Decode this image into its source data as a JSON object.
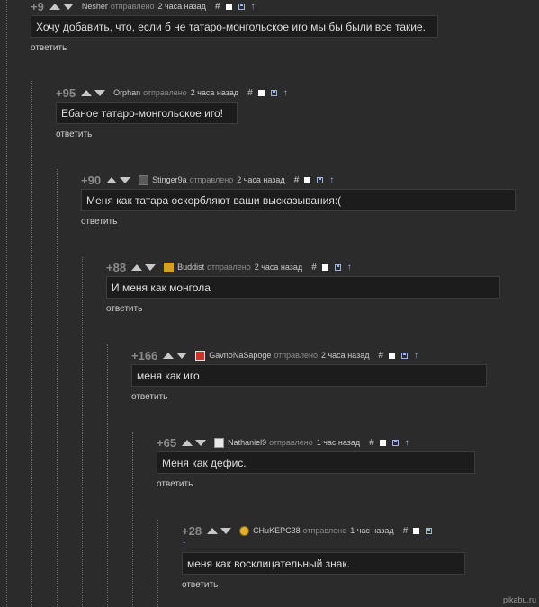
{
  "comments": [
    {
      "rating": "+9",
      "author": "Nesher",
      "sent": "отправлено",
      "time": "2 часа назад",
      "text": "Хочу добавить, что, если б не татаро-монгольское иго мы бы были все такие.",
      "reply": "ответить",
      "avatar": null
    },
    {
      "rating": "+95",
      "author": "Orphan",
      "sent": "отправлено",
      "time": "2 часа назад",
      "text": "Ебаное татаро-монгольское иго!",
      "reply": "ответить",
      "avatar": null
    },
    {
      "rating": "+90",
      "author": "Stinger9a",
      "sent": "отправлено",
      "time": "2 часа назад",
      "text": "Меня как татара оскорбляют ваши высказывания:(",
      "reply": "ответить",
      "avatar": "user-avatar"
    },
    {
      "rating": "+88",
      "author": "Buddist",
      "sent": "отправлено",
      "time": "2 часа назад",
      "text": "И меня как монгола",
      "reply": "ответить",
      "avatar": "user-avatar"
    },
    {
      "rating": "+166",
      "author": "GavnoNaSapoge",
      "sent": "отправлено",
      "time": "2 часа назад",
      "text": "меня как иго",
      "reply": "ответить",
      "avatar": "user-avatar"
    },
    {
      "rating": "+65",
      "author": "Nathaniel9",
      "sent": "отправлено",
      "time": "1 час назад",
      "text": "Меня как дефис.",
      "reply": "ответить",
      "avatar": "user-avatar"
    },
    {
      "rating": "+28",
      "author": "CHuKEPC38",
      "sent": "отправлено",
      "time": "1 час назад",
      "text": "меня как восклицательный знак.",
      "reply": "ответить",
      "avatar": "user-avatar"
    }
  ],
  "icons": {
    "hash": "#",
    "up_arrow": "↑"
  },
  "brand": "pikabu.ru",
  "colors": {
    "background": "#2b2b2b",
    "comment_body": "#1c1c1c",
    "link": "#9db7e2"
  }
}
